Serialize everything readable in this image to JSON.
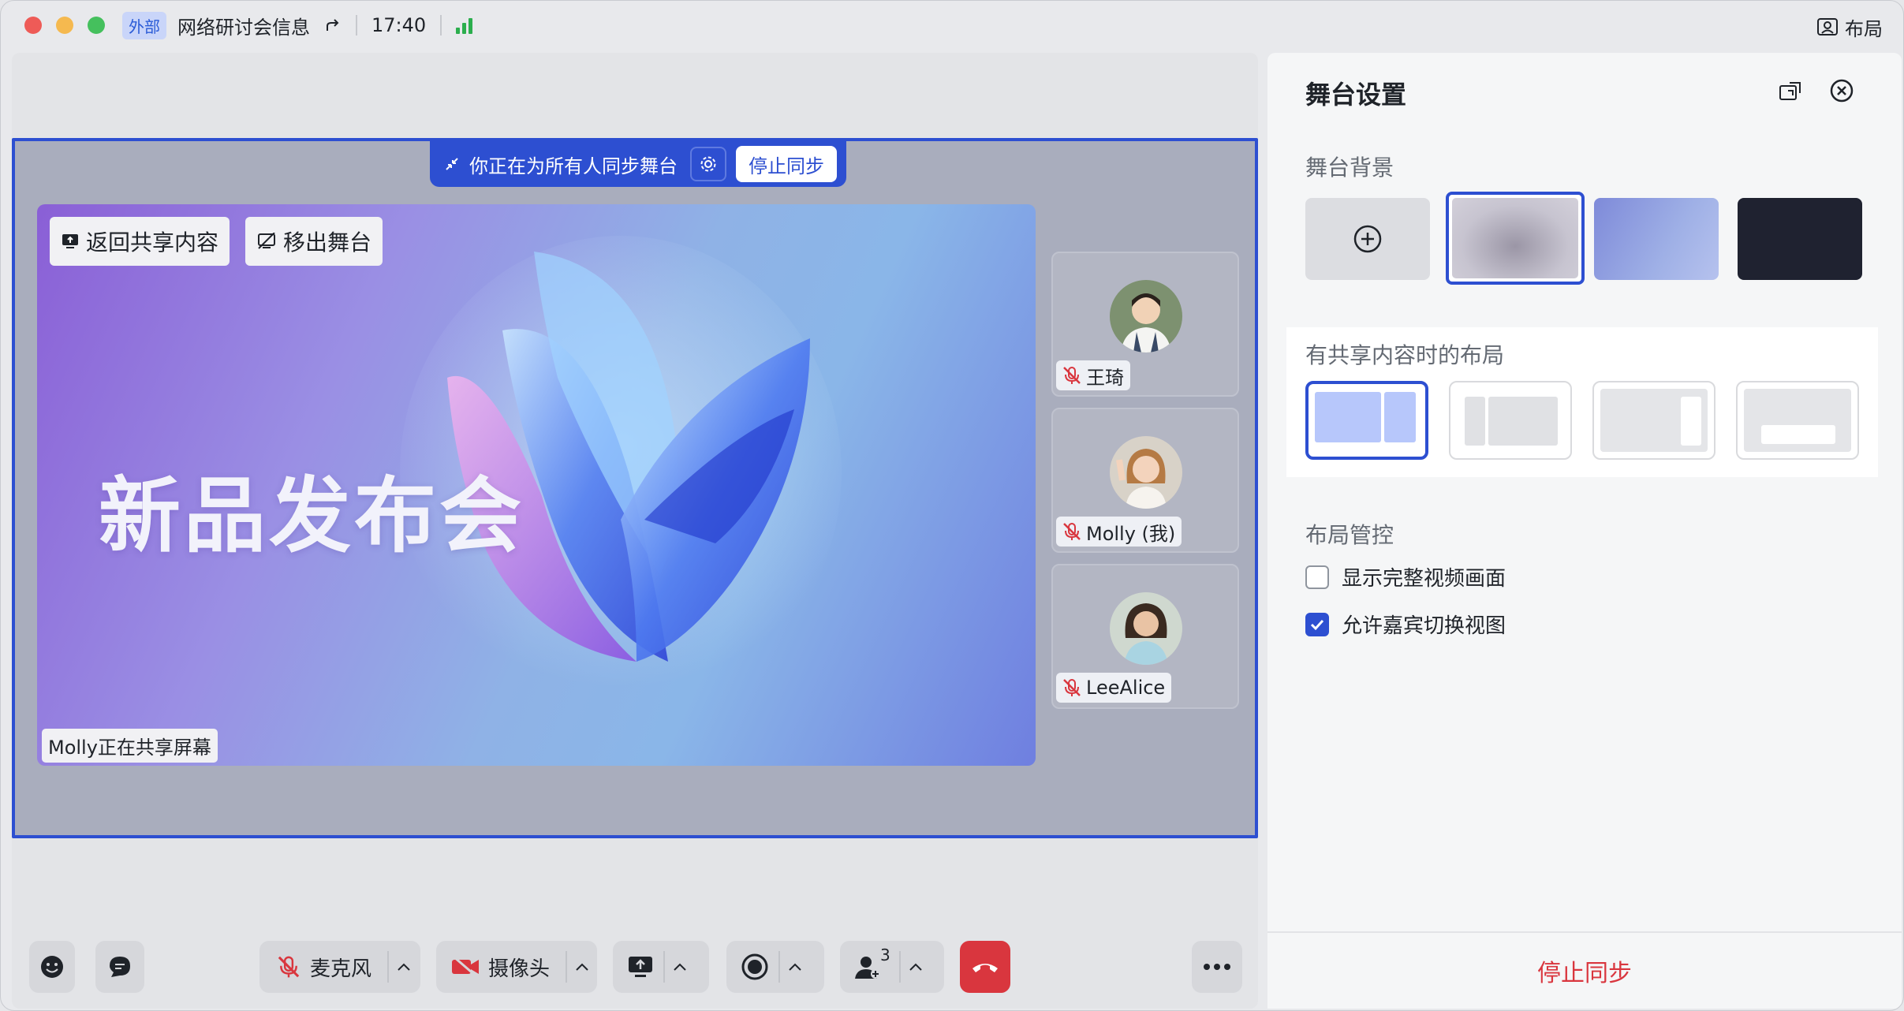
{
  "titlebar": {
    "tag": "外部",
    "meeting_title": "网络研讨会信息",
    "time": "17:40",
    "layout_label": "布局"
  },
  "stage": {
    "sync_text": "你正在为所有人同步舞台",
    "stop_sync_label": "停止同步",
    "back_to_share_label": "返回共享内容",
    "remove_from_stage_label": "移出舞台",
    "slide_title": "新品发布会",
    "sharer_text": "Molly正在共享屏幕"
  },
  "participants": [
    {
      "name": "王琦"
    },
    {
      "name": "Molly (我)"
    },
    {
      "name": "LeeAlice"
    }
  ],
  "toolbar": {
    "mic_label": "麦克风",
    "camera_label": "摄像头",
    "participants_count": "3"
  },
  "panel": {
    "title": "舞台设置",
    "bg_label": "舞台背景",
    "layout_label": "有共享内容时的布局",
    "control_label": "布局管控",
    "opt_full_video": "显示完整视频画面",
    "opt_allow_switch": "允许嘉宾切换视图",
    "opt_full_video_checked": false,
    "opt_allow_switch_checked": true,
    "stop_sync_label": "停止同步"
  },
  "colors": {
    "accent": "#2d4fd1",
    "danger": "#d9363e",
    "bg_blur": "#b8b5c6",
    "bg_gradient": "#8e9ce0",
    "bg_dark": "#1f2230"
  }
}
